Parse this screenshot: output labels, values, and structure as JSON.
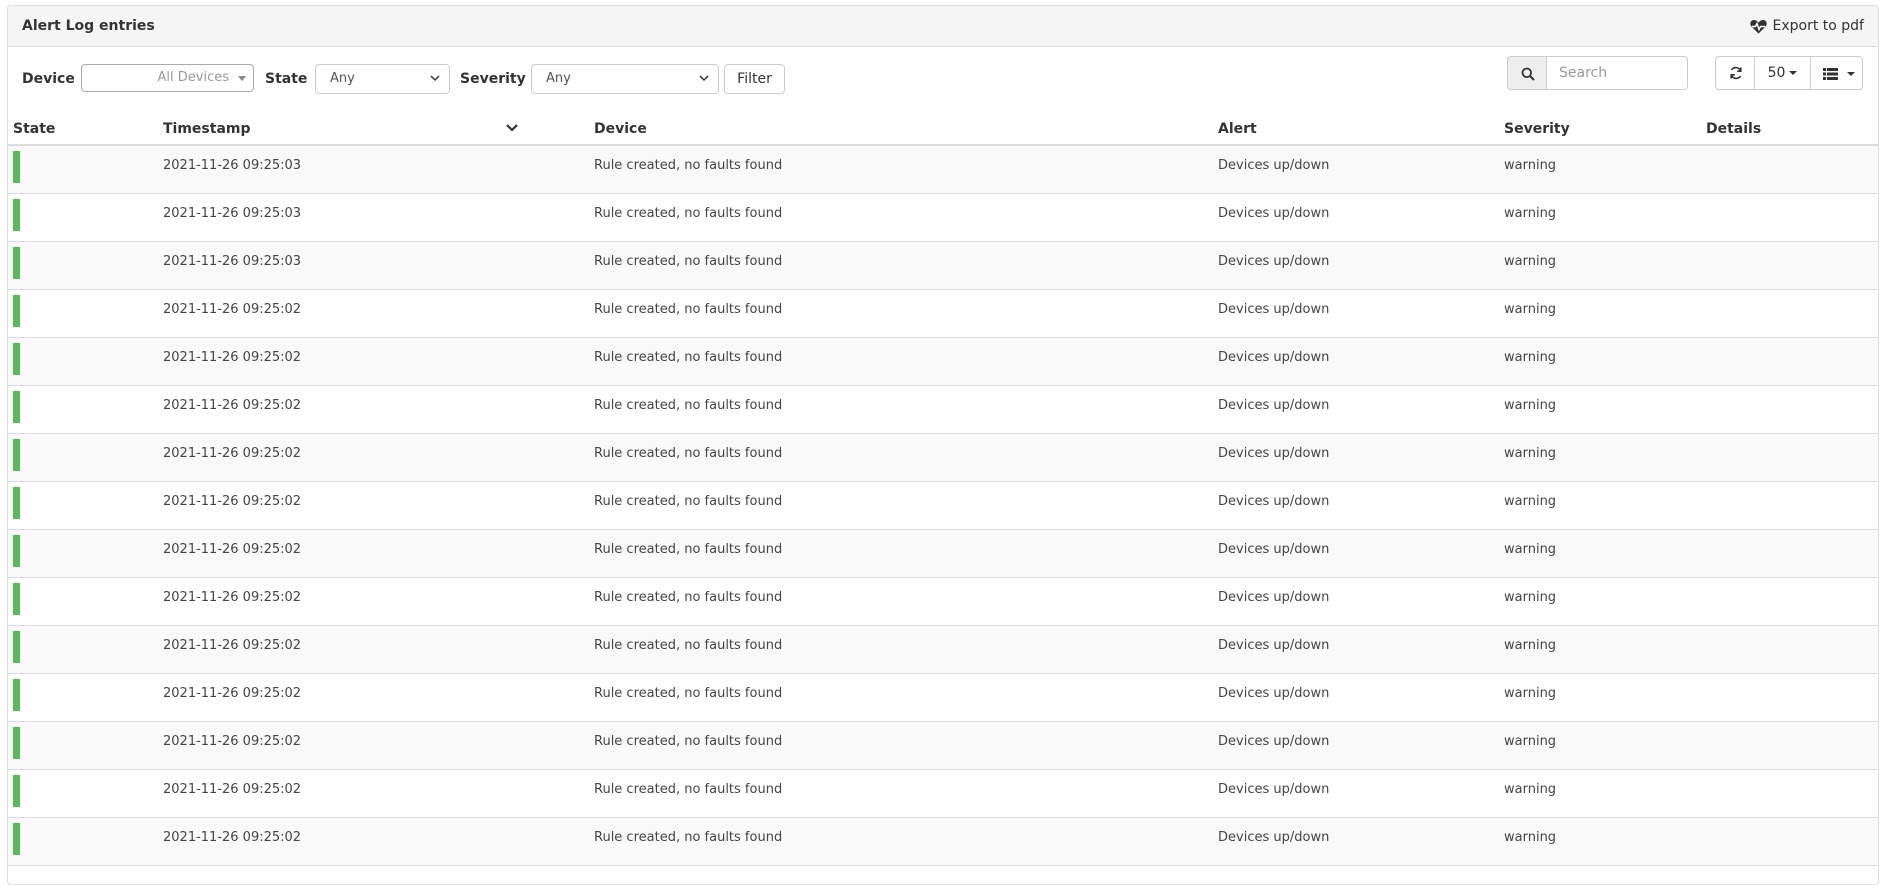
{
  "panel": {
    "title": "Alert Log entries",
    "export_label": "Export to pdf"
  },
  "filters": {
    "device_label": "Device",
    "device_value": "All Devices",
    "state_label": "State",
    "state_value": "Any",
    "severity_label": "Severity",
    "severity_value": "Any",
    "filter_button": "Filter"
  },
  "search": {
    "placeholder": "Search"
  },
  "page_size": "50",
  "columns": [
    "State",
    "Timestamp",
    "Device",
    "Alert",
    "Severity",
    "Details"
  ],
  "rows": [
    {
      "state_color": "#5cb85c",
      "timestamp": "2021-11-26 09:25:03",
      "device": "Rule created, no faults found",
      "alert": "Devices up/down",
      "severity": "warning",
      "details": ""
    },
    {
      "state_color": "#5cb85c",
      "timestamp": "2021-11-26 09:25:03",
      "device": "Rule created, no faults found",
      "alert": "Devices up/down",
      "severity": "warning",
      "details": ""
    },
    {
      "state_color": "#5cb85c",
      "timestamp": "2021-11-26 09:25:03",
      "device": "Rule created, no faults found",
      "alert": "Devices up/down",
      "severity": "warning",
      "details": ""
    },
    {
      "state_color": "#5cb85c",
      "timestamp": "2021-11-26 09:25:02",
      "device": "Rule created, no faults found",
      "alert": "Devices up/down",
      "severity": "warning",
      "details": ""
    },
    {
      "state_color": "#5cb85c",
      "timestamp": "2021-11-26 09:25:02",
      "device": "Rule created, no faults found",
      "alert": "Devices up/down",
      "severity": "warning",
      "details": ""
    },
    {
      "state_color": "#5cb85c",
      "timestamp": "2021-11-26 09:25:02",
      "device": "Rule created, no faults found",
      "alert": "Devices up/down",
      "severity": "warning",
      "details": ""
    },
    {
      "state_color": "#5cb85c",
      "timestamp": "2021-11-26 09:25:02",
      "device": "Rule created, no faults found",
      "alert": "Devices up/down",
      "severity": "warning",
      "details": ""
    },
    {
      "state_color": "#5cb85c",
      "timestamp": "2021-11-26 09:25:02",
      "device": "Rule created, no faults found",
      "alert": "Devices up/down",
      "severity": "warning",
      "details": ""
    },
    {
      "state_color": "#5cb85c",
      "timestamp": "2021-11-26 09:25:02",
      "device": "Rule created, no faults found",
      "alert": "Devices up/down",
      "severity": "warning",
      "details": ""
    },
    {
      "state_color": "#5cb85c",
      "timestamp": "2021-11-26 09:25:02",
      "device": "Rule created, no faults found",
      "alert": "Devices up/down",
      "severity": "warning",
      "details": ""
    },
    {
      "state_color": "#5cb85c",
      "timestamp": "2021-11-26 09:25:02",
      "device": "Rule created, no faults found",
      "alert": "Devices up/down",
      "severity": "warning",
      "details": ""
    },
    {
      "state_color": "#5cb85c",
      "timestamp": "2021-11-26 09:25:02",
      "device": "Rule created, no faults found",
      "alert": "Devices up/down",
      "severity": "warning",
      "details": ""
    },
    {
      "state_color": "#5cb85c",
      "timestamp": "2021-11-26 09:25:02",
      "device": "Rule created, no faults found",
      "alert": "Devices up/down",
      "severity": "warning",
      "details": ""
    },
    {
      "state_color": "#5cb85c",
      "timestamp": "2021-11-26 09:25:02",
      "device": "Rule created, no faults found",
      "alert": "Devices up/down",
      "severity": "warning",
      "details": ""
    },
    {
      "state_color": "#5cb85c",
      "timestamp": "2021-11-26 09:25:02",
      "device": "Rule created, no faults found",
      "alert": "Devices up/down",
      "severity": "warning",
      "details": ""
    }
  ],
  "icons": {
    "export": "heartbeat-icon",
    "search": "search-icon",
    "refresh": "refresh-icon",
    "columns": "list-icon",
    "sort": "chevron-down-icon"
  }
}
